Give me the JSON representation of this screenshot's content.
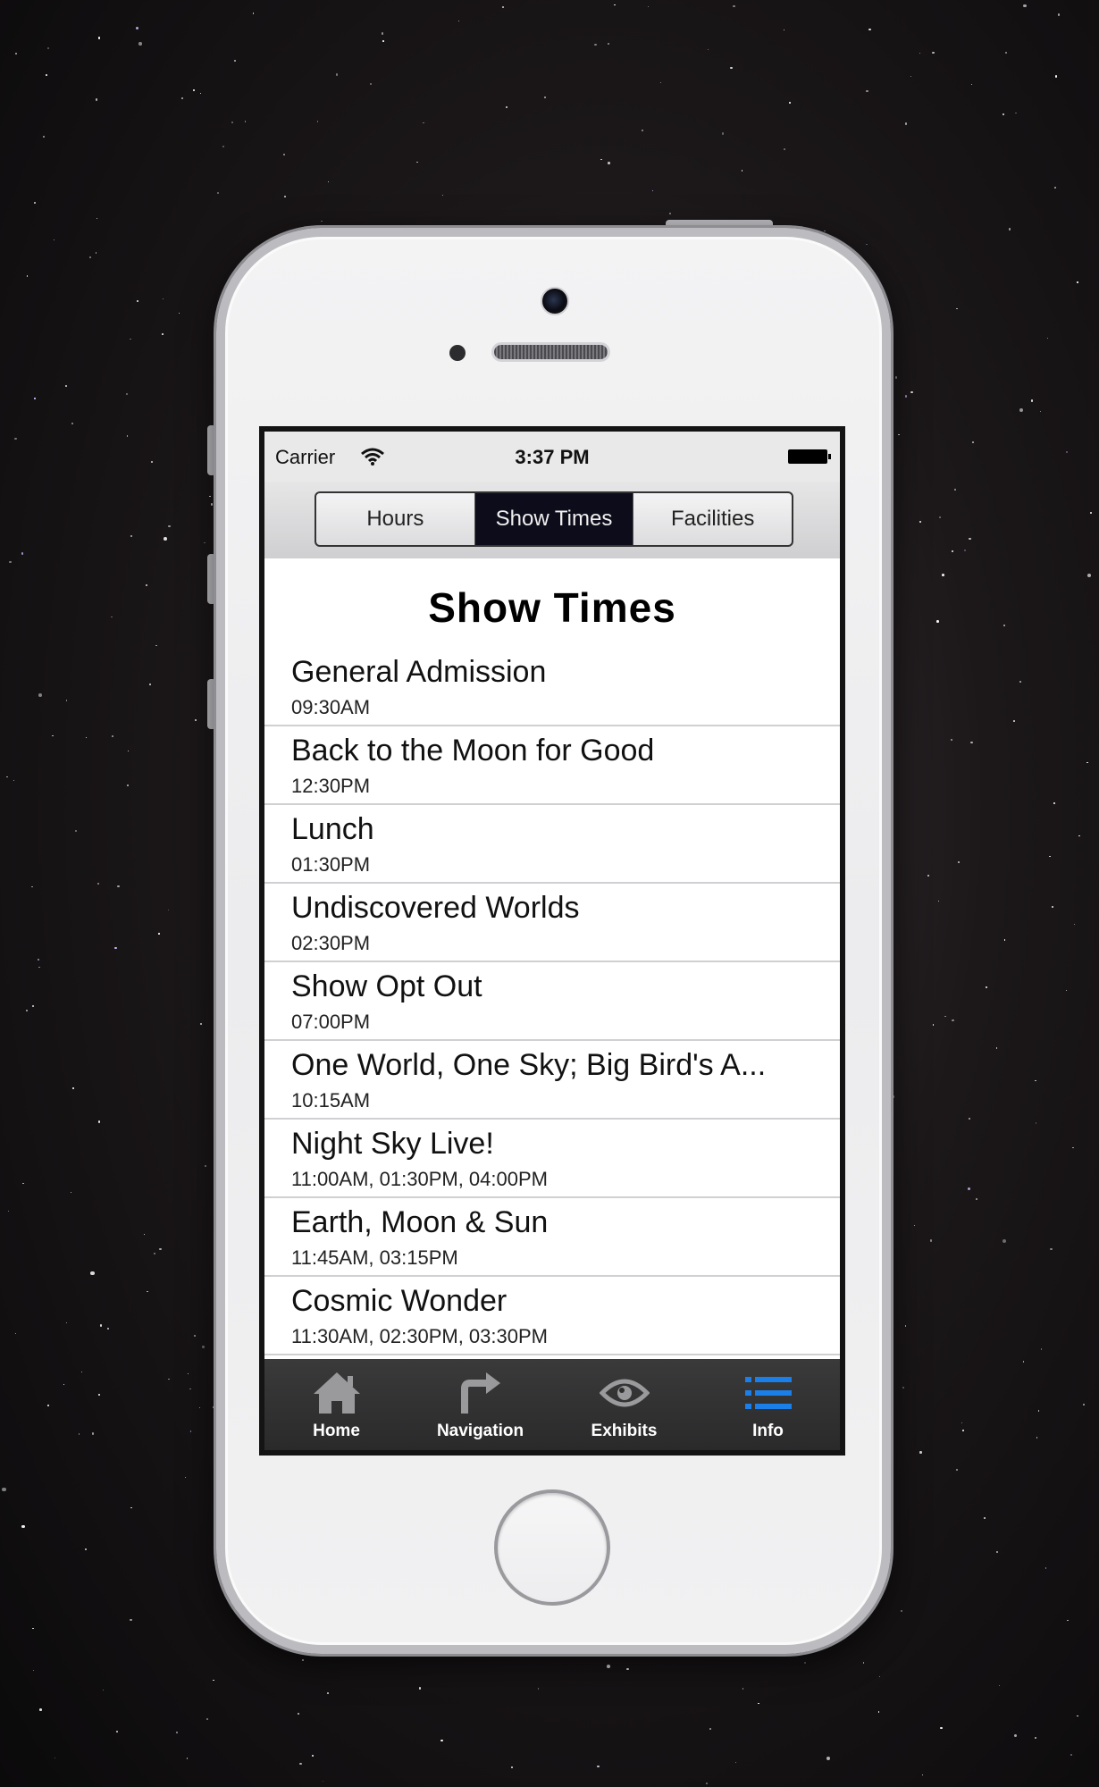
{
  "status_bar": {
    "carrier": "Carrier",
    "time": "3:37 PM"
  },
  "segments": [
    {
      "label": "Hours",
      "active": false
    },
    {
      "label": "Show Times",
      "active": true
    },
    {
      "label": "Facilities",
      "active": false
    }
  ],
  "page": {
    "title": "Show Times"
  },
  "shows": [
    {
      "title": "General Admission",
      "times": "09:30AM"
    },
    {
      "title": "Back to the Moon for Good",
      "times": "12:30PM"
    },
    {
      "title": "Lunch",
      "times": "01:30PM"
    },
    {
      "title": "Undiscovered Worlds",
      "times": "02:30PM"
    },
    {
      "title": "Show Opt Out",
      "times": "07:00PM"
    },
    {
      "title": "One World, One Sky; Big Bird's A...",
      "times": "10:15AM"
    },
    {
      "title": "Night Sky Live!",
      "times": "11:00AM, 01:30PM, 04:00PM"
    },
    {
      "title": "Earth, Moon & Sun",
      "times": "11:45AM, 03:15PM"
    },
    {
      "title": "Cosmic Wonder",
      "times": "11:30AM, 02:30PM, 03:30PM"
    }
  ],
  "tabs": [
    {
      "label": "Home",
      "icon": "home-icon",
      "active": false
    },
    {
      "label": "Navigation",
      "icon": "turn-arrow-icon",
      "active": false
    },
    {
      "label": "Exhibits",
      "icon": "eye-icon",
      "active": false
    },
    {
      "label": "Info",
      "icon": "list-icon",
      "active": true
    }
  ],
  "colors": {
    "active_tab": "#1a7fe8",
    "inactive_tab_icon": "#9a9a9c",
    "segment_active_bg": "#0d0c1a"
  }
}
